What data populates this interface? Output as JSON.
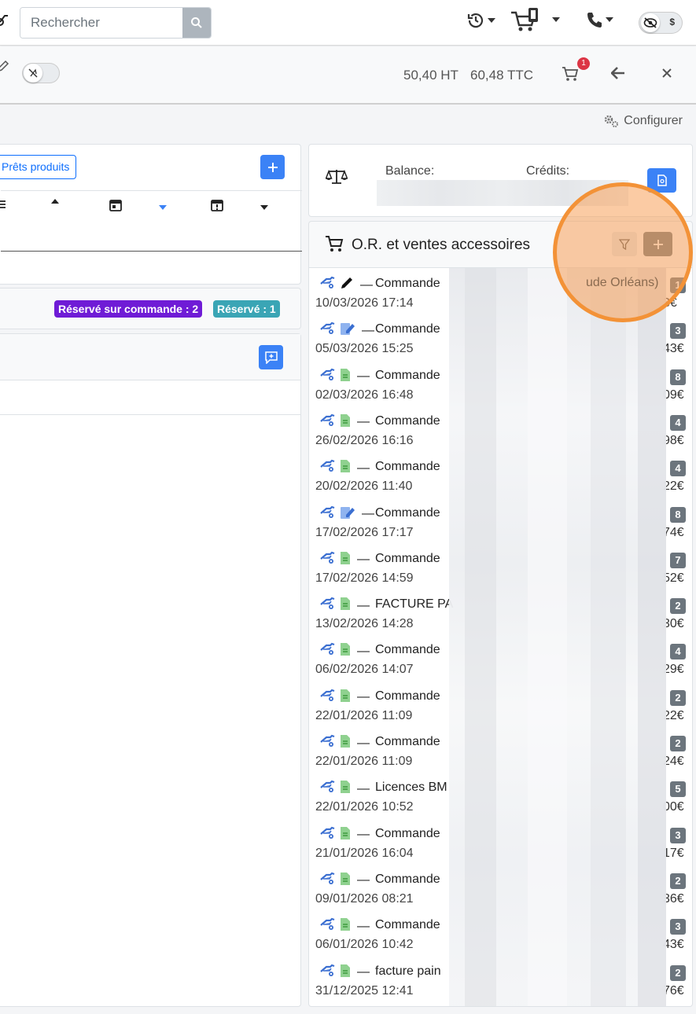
{
  "topbar": {
    "search_placeholder": "Rechercher"
  },
  "subbar": {
    "price_ht": "50,40 HT",
    "price_ttc": "60,48 TTC",
    "cart_badge": "1"
  },
  "configurer_label": "Configurer",
  "loans_card": {
    "button_label": "Prêts produits"
  },
  "reservation": {
    "reserved_on_order": "Réservé sur commande : 2",
    "reserved": "Réservé : 1"
  },
  "balance_card": {
    "balance_label": "Balance:",
    "credits_label": "Crédits:"
  },
  "orders": {
    "title": "O.R. et ventes accessoires",
    "first_suffix": "ude Orléans)",
    "rows": [
      {
        "label": "Commande",
        "date": "10/03/2026 17:14",
        "count": "1",
        "amount": "3€",
        "doc": "pen"
      },
      {
        "label": "Commande",
        "date": "05/03/2026 15:25",
        "count": "3",
        "amount": "43€",
        "doc": "edit"
      },
      {
        "label": "Commande",
        "date": "02/03/2026 16:48",
        "count": "8",
        "amount": "09€",
        "doc": "file"
      },
      {
        "label": "Commande",
        "date": "26/02/2026 16:16",
        "count": "4",
        "amount": "98€",
        "doc": "file"
      },
      {
        "label": "Commande",
        "date": "20/02/2026 11:40",
        "count": "4",
        "amount": "22€",
        "doc": "file"
      },
      {
        "label": "Commande",
        "date": "17/02/2026 17:17",
        "count": "8",
        "amount": "74€",
        "doc": "edit"
      },
      {
        "label": "Commande",
        "date": "17/02/2026 14:59",
        "count": "7",
        "amount": "52€",
        "doc": "file"
      },
      {
        "label": "FACTURE PA",
        "date": "13/02/2026 14:28",
        "count": "2",
        "amount": "30€",
        "doc": "file"
      },
      {
        "label": "Commande",
        "date": "06/02/2026 14:07",
        "count": "4",
        "amount": "29€",
        "doc": "file"
      },
      {
        "label": "Commande",
        "date": "22/01/2026 11:09",
        "count": "2",
        "amount": "22€",
        "doc": "file"
      },
      {
        "label": "Commande",
        "date": "22/01/2026 11:09",
        "count": "2",
        "amount": "24€",
        "doc": "file"
      },
      {
        "label": "Licences BM",
        "date": "22/01/2026 10:52",
        "count": "5",
        "amount": "00€",
        "doc": "file"
      },
      {
        "label": "Commande",
        "date": "21/01/2026 16:04",
        "count": "3",
        "amount": "17€",
        "doc": "file"
      },
      {
        "label": "Commande",
        "date": "09/01/2026 08:21",
        "count": "2",
        "amount": "36€",
        "doc": "file"
      },
      {
        "label": "Commande",
        "date": "06/01/2026 10:42",
        "count": "3",
        "amount": "43€",
        "doc": "file"
      },
      {
        "label": "facture pain",
        "date": "31/12/2025 12:41",
        "count": "2",
        "amount": "76€",
        "doc": "file"
      }
    ]
  },
  "colors": {
    "primary": "#3b82f6",
    "badge_purple": "#6f1bd6",
    "badge_teal": "#3aa5b5",
    "count_badge": "#6c757d",
    "highlight_ring": "#f39237"
  }
}
